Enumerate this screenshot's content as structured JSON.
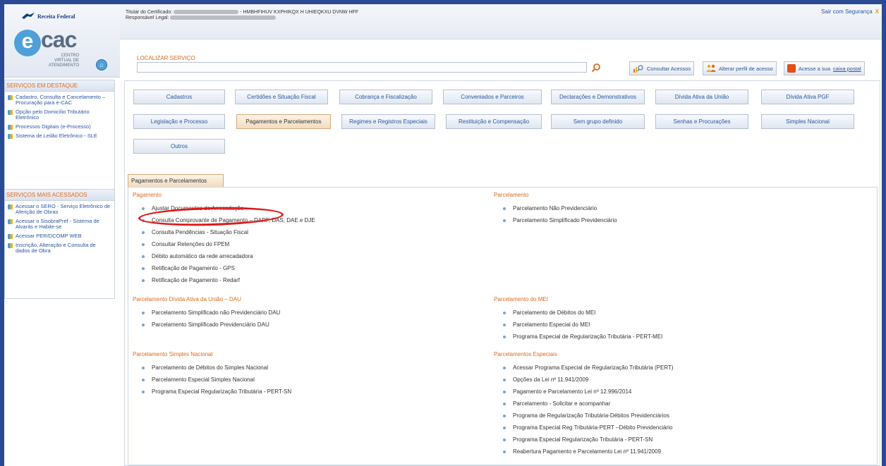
{
  "brand": {
    "receita_text": "Receita Federal",
    "ecac_e": "e",
    "ecac_cac": "cac",
    "ecac_sub": "CENTRO VIRTUAL DE ATENDIMENTO"
  },
  "header": {
    "cert_label": "Titular do Certificado:",
    "cert_name": "- HMBHFIHUV KXPHIKQX H UHIEQKXU DVNW HFF",
    "resp_label": "Responsável Legal:",
    "logout": "Sair com Segurança",
    "logout_x": "X"
  },
  "search": {
    "label": "LOCALIZAR SERVIÇO",
    "value": "",
    "consultar": "Consultar Acessos",
    "alterar": "Alterar perfil de acesso",
    "acesse_prefix": "Acesse a sua",
    "caixa": "caixa postal"
  },
  "sidebar": {
    "destaque_title": "SERVIÇOS EM DESTAQUE",
    "destaque": [
      "Cadastro, Consulta e Cancelamento – Procuração para e-CAC",
      "Opção pelo Domicílio Tributário Eletrônico",
      "Processos Digitais (e-Processo)",
      "Sistema de Leilão Eletrônico - SLE"
    ],
    "acessados_title": "SERVIÇOS MAIS ACESSADOS",
    "acessados": [
      "Acessar o SERO - Serviço Eletrônico de Aferição de Obras",
      "Acessar o SisobraPref - Sistema de Alvarás e Habite-se",
      "Acessar PER/DCOMP WEB",
      "Inscrição, Alteração e Consulta de dados de Obra"
    ]
  },
  "categories": [
    "Cadastros",
    "Certidões e Situação Fiscal",
    "Cobrança e Fiscalização",
    "Conveniados e Parceiros",
    "Declarações e Demonstrativos",
    "Dívida Ativa da União",
    "Dívida Ativa PGF",
    "Legislação e Processo",
    "Pagamentos e Parcelamentos",
    "Regimes e Registros Especiais",
    "Restituição e Compensação",
    "Sem grupo definido",
    "Senhas e Procurações",
    "Simples Nacional",
    "Outros"
  ],
  "tab_label": "Pagamentos e Parcelamentos",
  "sections": {
    "pagamento": {
      "title": "Pagamento",
      "items": [
        "Ajustar Documentos de Arrecadação",
        "Consulta Comprovante de Pagamento – DARF, DAS, DAE e DJE",
        "Consulta Pendências - Situação Fiscal",
        "Consultar Retenções do FPEM",
        "Débito automático da rede arrecadadora",
        "Retificação de Pagamento - GPS",
        "Retificação de Pagamento - Redarf"
      ]
    },
    "parcelamento": {
      "title": "Parcelamento",
      "items": [
        "Parcelamento Não Previdenciário",
        "Parcelamento Simplificado Previdenciário"
      ]
    },
    "dau": {
      "title": "Parcelamento Dívida Ativa da União – DAU",
      "items": [
        "Parcelamento Simplificado não Previdenciário DAU",
        "Parcelamento Simplificado Previdenciário DAU"
      ]
    },
    "mei": {
      "title": "Parcelamento do MEI",
      "items": [
        "Parcelamento de Débitos do MEI",
        "Parcelamento Especial do MEI",
        "Programa Especial de Regularização Tributária - PERT-MEI"
      ]
    },
    "simples": {
      "title": "Parcelamento Simples Nacional",
      "items": [
        "Parcelamento de Débitos do Simples Nacional",
        "Parcelamento Especial Simples Nacional",
        "Programa Especial Regularização Tributária - PERT-SN"
      ]
    },
    "especiais": {
      "title": "Parcelamentos Especiais",
      "items": [
        "Acessar Programa Especial de Regularização Tributária (PERT)",
        "Opções da Lei nº 11.941/2009",
        "Pagamento e Parcelamento Lei nº 12.996/2014",
        "Parcelamento - Solicitar e acompanhar",
        "Programa de Regularização Tributária-Débitos Previdenciários",
        "Programa Especial Reg Tributária-PERT –Débito Previdenciário",
        "Programa Especial Regularização Tributária - PERT-SN",
        "Reabertura Pagamento e Parcelamento Lei nº 11.941/2009"
      ]
    }
  },
  "colors": {
    "accent_orange": "#e06a1b",
    "link_blue": "#2a55a0",
    "frame_blue": "#2a4a93",
    "highlight_red": "#e01a1a"
  }
}
